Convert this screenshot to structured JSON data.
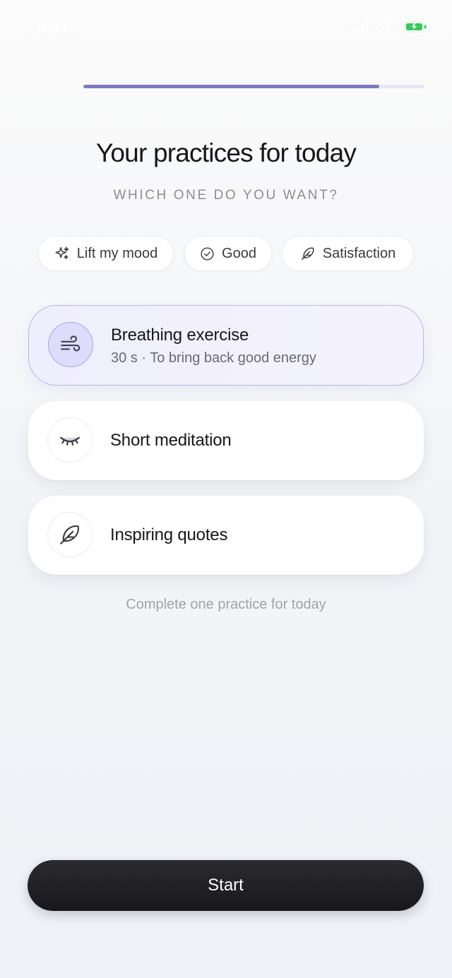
{
  "status_bar": {
    "time": "9:41"
  },
  "progress": {
    "fraction": 0.87,
    "color": "#7b79c8"
  },
  "header": {
    "title": "Your practices for today",
    "subtitle": "WHICH ONE DO YOU WANT?"
  },
  "chips": [
    {
      "label": "Lift my mood",
      "icon": "sparkle-icon"
    },
    {
      "label": "Good",
      "icon": "check-circle-icon"
    },
    {
      "label": "Satisfaction",
      "icon": "feather-icon"
    }
  ],
  "practices": [
    {
      "title": "Breathing exercise",
      "subtitle": "30 s · To bring back good energy",
      "icon": "wind-icon",
      "selected": true
    },
    {
      "title": "Short meditation",
      "icon": "closed-eye-icon",
      "selected": false
    },
    {
      "title": "Inspiring quotes",
      "icon": "feather-icon",
      "selected": false
    }
  ],
  "footnote": "Complete one practice for today",
  "start_button": {
    "label": "Start"
  },
  "colors": {
    "accent": "#7b79c8",
    "selected_bg": "#efeefc",
    "button_bg": "#1c1c20"
  }
}
